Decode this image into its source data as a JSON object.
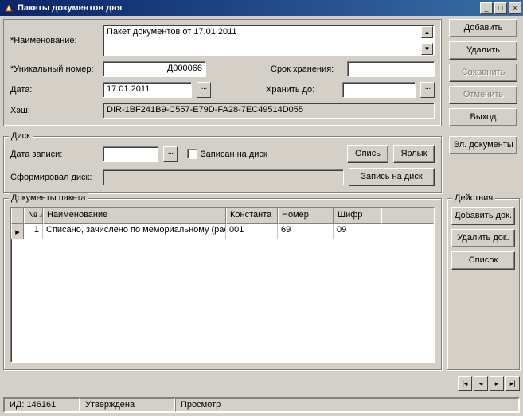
{
  "window": {
    "title": "Пакеты документов дня"
  },
  "header": {
    "name_label": "*Наименование:",
    "name_value": "Пакет документов от 17.01.2011",
    "uid_label": "*Уникальный номер:",
    "uid_value": "Д000066",
    "retention_label": "Срок хранения:",
    "retention_value": "",
    "date_label": "Дата:",
    "date_value": "17.01.2011",
    "store_until_label": "Хранить до:",
    "store_until_value": "",
    "hash_label": "Хэш:",
    "hash_value": "DIR-1BF241B9-C557-E79D-FA28-7EC49514D055"
  },
  "buttons": {
    "add": "Добавить",
    "delete": "Удалить",
    "save": "Сохранить",
    "cancel": "Отменить",
    "exit": "Выход",
    "edocs": "Эл. документы",
    "inventory": "Опись",
    "label": "Ярлык",
    "write_disc": "Запись на диск",
    "add_doc": "Добавить док.",
    "del_doc": "Удалить док.",
    "list": "Список"
  },
  "disc": {
    "legend": "Диск",
    "rec_date_label": "Дата записи:",
    "rec_date_value": "",
    "written_label": "Записан на диск",
    "formed_label": "Сформировал диск:",
    "formed_value": ""
  },
  "docs": {
    "legend": "Документы пакета",
    "actions_legend": "Действия",
    "cols": {
      "n": "№",
      "name": "Наименование",
      "const": "Константа",
      "num": "Номер",
      "code": "Шифр"
    },
    "rows": [
      {
        "n": "1",
        "name": "Списано, зачислено по мемориальному (расх…",
        "const": "001",
        "num": "69",
        "code": "09"
      }
    ]
  },
  "status": {
    "id_label": "ИД:",
    "id_value": "146161",
    "state": "Утверждена",
    "mode": "Просмотр"
  }
}
